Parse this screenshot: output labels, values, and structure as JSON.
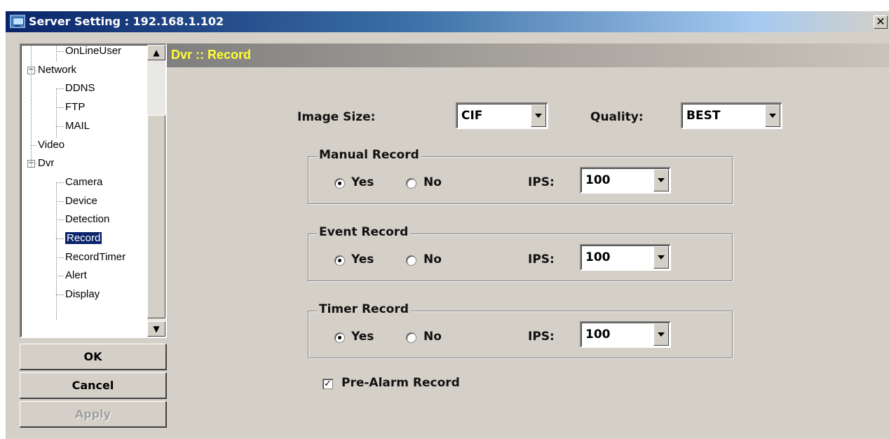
{
  "window": {
    "title": "Server Setting : 192.168.1.102",
    "close_glyph": "✕"
  },
  "tree": {
    "items": [
      {
        "label": "OnLineUser",
        "level": 2
      },
      {
        "label": "Network",
        "level": 1,
        "expander": "−"
      },
      {
        "label": "DDNS",
        "level": 2
      },
      {
        "label": "FTP",
        "level": 2
      },
      {
        "label": "MAIL",
        "level": 2
      },
      {
        "label": "Video",
        "level": 1
      },
      {
        "label": "Dvr",
        "level": 1,
        "expander": "−"
      },
      {
        "label": "Camera",
        "level": 2
      },
      {
        "label": "Device",
        "level": 2
      },
      {
        "label": "Detection",
        "level": 2
      },
      {
        "label": "Record",
        "level": 2,
        "selected": true
      },
      {
        "label": "RecordTimer",
        "level": 2
      },
      {
        "label": "Alert",
        "level": 2
      },
      {
        "label": "Display",
        "level": 2
      }
    ],
    "scroll_up": "▲",
    "scroll_down": "▼"
  },
  "buttons": {
    "ok": "OK",
    "cancel": "Cancel",
    "apply": "Apply"
  },
  "section": {
    "title": "Dvr :: Record"
  },
  "image_size": {
    "label": "Image Size:",
    "value": "CIF"
  },
  "quality": {
    "label": "Quality:",
    "value": "BEST"
  },
  "groups": {
    "manual": {
      "title": "Manual Record",
      "yes": "Yes",
      "no": "No",
      "selected": "Yes",
      "ips_label": "IPS:",
      "ips_value": "100"
    },
    "event": {
      "title": "Event Record",
      "yes": "Yes",
      "no": "No",
      "selected": "Yes",
      "ips_label": "IPS:",
      "ips_value": "100"
    },
    "timer": {
      "title": "Timer Record",
      "yes": "Yes",
      "no": "No",
      "selected": "Yes",
      "ips_label": "IPS:",
      "ips_value": "100"
    }
  },
  "pre_alarm": {
    "label": "Pre-Alarm Record",
    "checked": true,
    "check_glyph": "✓"
  },
  "colors": {
    "title_bar": "#0a246a",
    "section_title": "#ffff33",
    "selection": "#0a246a",
    "face": "#d4d0c8"
  }
}
